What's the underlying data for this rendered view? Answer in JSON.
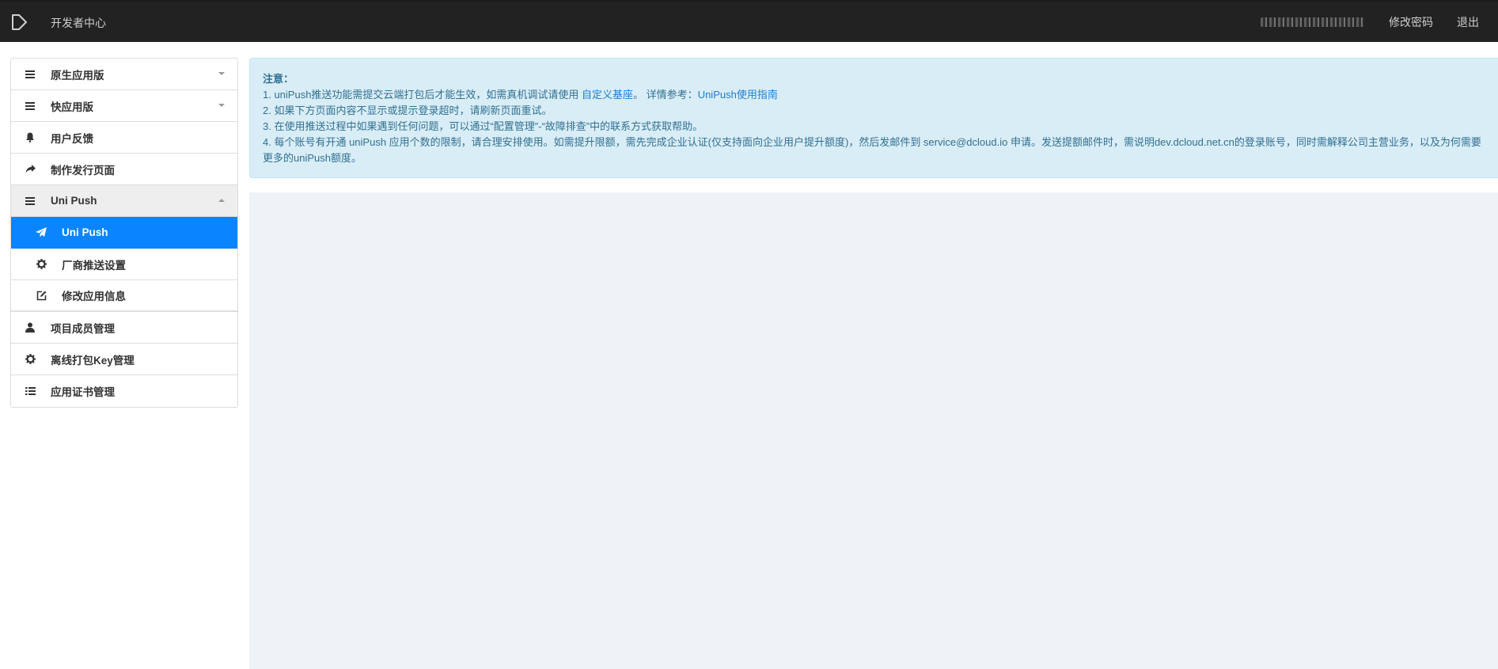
{
  "header": {
    "brand": "开发者中心",
    "links": [
      "修改密码",
      "退出"
    ]
  },
  "sidebar": {
    "items": [
      {
        "label": "原生应用版",
        "icon": "list-icon",
        "caret": "down"
      },
      {
        "label": "快应用版",
        "icon": "list-icon",
        "caret": "down"
      },
      {
        "label": "用户反馈",
        "icon": "bell-icon"
      },
      {
        "label": "制作发行页面",
        "icon": "share-icon"
      },
      {
        "label": "Uni Push",
        "icon": "list-icon",
        "caret": "up",
        "open": true
      },
      {
        "label": "Uni Push",
        "icon": "send-icon",
        "sub": true,
        "active": true
      },
      {
        "label": "厂商推送设置",
        "icon": "gear-icon",
        "sub": true
      },
      {
        "label": "修改应用信息",
        "icon": "edit-icon",
        "sub": true
      },
      {
        "label": "项目成员管理",
        "icon": "user-icon"
      },
      {
        "label": "离线打包Key管理",
        "icon": "gear-icon"
      },
      {
        "label": "应用证书管理",
        "icon": "list-bullets-icon"
      }
    ]
  },
  "notice": {
    "title": "注意：",
    "line1_pre": "1. uniPush推送功能需提交云端打包后才能生效，如需真机调试请使用 ",
    "line1_link1": "自定义基座",
    "line1_mid": "。 详情参考：",
    "line1_link2": "UniPush使用指南",
    "line2": "2. 如果下方页面内容不显示或提示登录超时，请刷新页面重试。",
    "line3": "3. 在使用推送过程中如果遇到任何问题，可以通过“配置管理”-“故障排查”中的联系方式获取帮助。",
    "line4": "4. 每个账号有开通 uniPush 应用个数的限制，请合理安排使用。如需提升限额，需先完成企业认证(仅支持面向企业用户提升额度)，然后发邮件到 service@dcloud.io 申请。发送提额邮件时，需说明dev.dcloud.net.cn的登录账号，同时需解释公司主营业务，以及为何需要更多的uniPush额度。"
  },
  "colors": {
    "topbar": "#222222",
    "accent": "#0a84ff",
    "notice_bg": "#d9edf7",
    "notice_text": "#31708f",
    "content_bg": "#eef3f8"
  }
}
